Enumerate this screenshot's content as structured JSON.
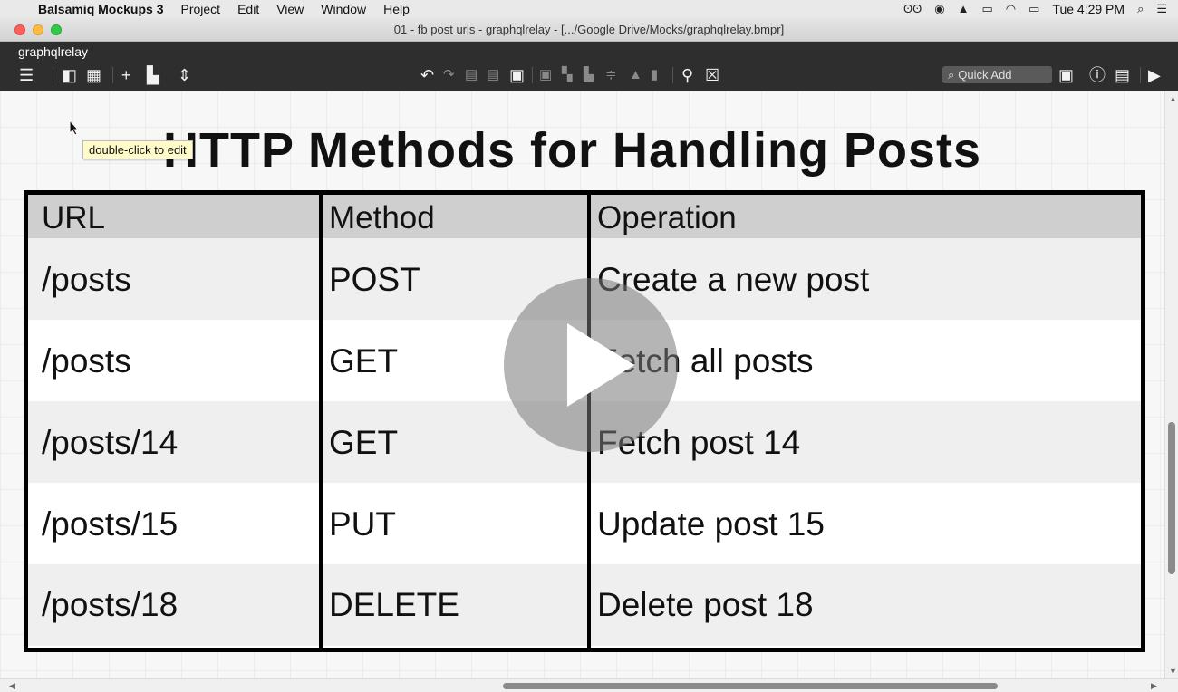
{
  "menubar": {
    "apple": "",
    "app_name": "Balsamiq Mockups 3",
    "items": [
      "Project",
      "Edit",
      "View",
      "Window",
      "Help"
    ],
    "clock": "Tue 4:29 PM"
  },
  "window": {
    "title": "01 - fb post urls - graphqlrelay - [.../Google Drive/Mocks/graphqlrelay.bmpr]"
  },
  "toolbar": {
    "project_name": "graphqlrelay",
    "quick_add_placeholder": "Quick Add"
  },
  "canvas": {
    "title": "HTTP Methods for Handling Posts",
    "tooltip": "double-click to edit"
  },
  "table": {
    "headers": [
      "URL",
      "Method",
      "Operation"
    ],
    "rows": [
      [
        "/posts",
        "POST",
        "Create a new post"
      ],
      [
        "/posts",
        "GET",
        "Fetch all posts"
      ],
      [
        "/posts/14",
        "GET",
        "Fetch post 14"
      ],
      [
        "/posts/15",
        "PUT",
        "Update post 15"
      ],
      [
        "/posts/18",
        "DELETE",
        "Delete post 18"
      ]
    ]
  }
}
